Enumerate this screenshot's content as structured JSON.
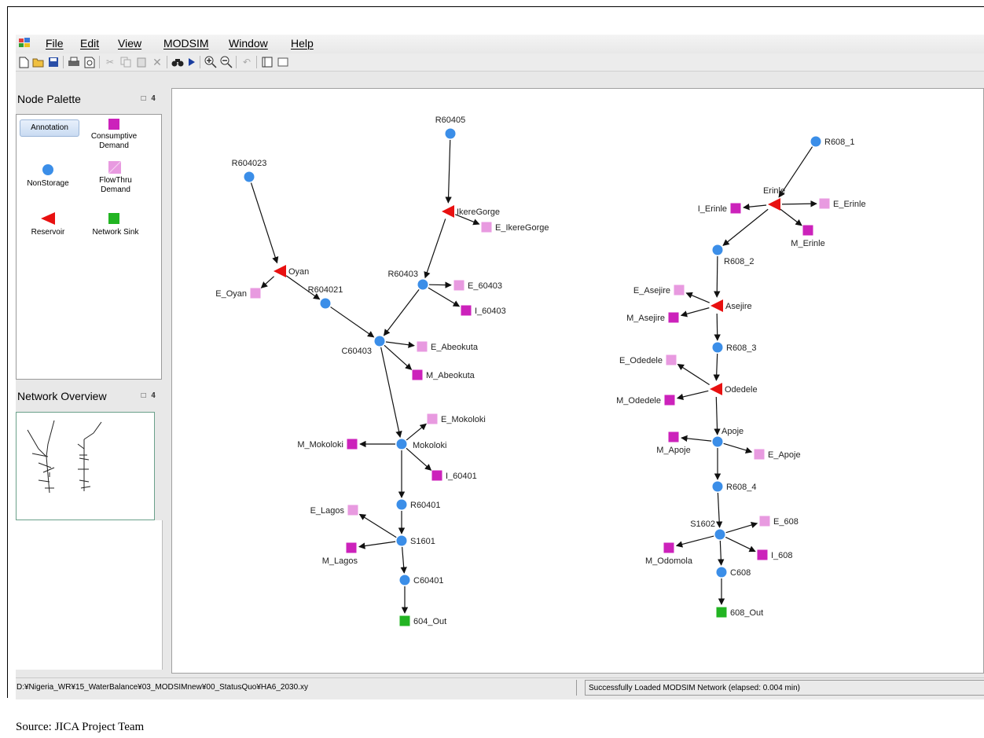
{
  "menu": [
    "File",
    "Edit",
    "View",
    "MODSIM",
    "Window",
    "Help"
  ],
  "panels": {
    "node_palette": "Node Palette",
    "network_overview": "Network Overview",
    "pin": "□ 𝟒"
  },
  "palette": {
    "annotation": "Annotation",
    "consumptive_demand": "Consumptive Demand",
    "nonstorage": "NonStorage",
    "flowthru_demand": "FlowThru Demand",
    "reservoir": "Reservoir",
    "network_sink": "Network Sink"
  },
  "colors": {
    "nonstorage": "#3b8ee8",
    "reservoir": "#e81010",
    "consumptive": "#cc22bb",
    "flowthru": "#e89ae0",
    "sink": "#22b422"
  },
  "network": {
    "nodes": [
      {
        "id": "R604023",
        "type": "nonstorage"
      },
      {
        "id": "Oyan",
        "type": "reservoir"
      },
      {
        "id": "E_Oyan",
        "type": "flowthru"
      },
      {
        "id": "R604021",
        "type": "nonstorage"
      },
      {
        "id": "R60405",
        "type": "nonstorage"
      },
      {
        "id": "IkereGorge",
        "type": "reservoir"
      },
      {
        "id": "E_IkereGorge",
        "type": "flowthru"
      },
      {
        "id": "R60403",
        "type": "nonstorage"
      },
      {
        "id": "E_60403",
        "type": "flowthru"
      },
      {
        "id": "I_60403",
        "type": "consumptive"
      },
      {
        "id": "C60403",
        "type": "nonstorage"
      },
      {
        "id": "E_Abeokuta",
        "type": "flowthru"
      },
      {
        "id": "M_Abeokuta",
        "type": "consumptive"
      },
      {
        "id": "Mokoloki",
        "type": "nonstorage"
      },
      {
        "id": "E_Mokoloki",
        "type": "flowthru"
      },
      {
        "id": "M_Mokoloki",
        "type": "consumptive"
      },
      {
        "id": "I_60401",
        "type": "consumptive"
      },
      {
        "id": "R60401",
        "type": "nonstorage"
      },
      {
        "id": "S1601",
        "type": "nonstorage"
      },
      {
        "id": "E_Lagos",
        "type": "flowthru"
      },
      {
        "id": "M_Lagos",
        "type": "consumptive"
      },
      {
        "id": "C60401",
        "type": "nonstorage"
      },
      {
        "id": "604_Out",
        "type": "sink"
      },
      {
        "id": "R608_1",
        "type": "nonstorage"
      },
      {
        "id": "Erinle",
        "type": "reservoir"
      },
      {
        "id": "I_Erinle",
        "type": "consumptive"
      },
      {
        "id": "E_Erinle",
        "type": "flowthru"
      },
      {
        "id": "M_Erinle",
        "type": "consumptive"
      },
      {
        "id": "R608_2",
        "type": "nonstorage"
      },
      {
        "id": "Asejire",
        "type": "reservoir"
      },
      {
        "id": "E_Asejire",
        "type": "flowthru"
      },
      {
        "id": "M_Asejire",
        "type": "consumptive"
      },
      {
        "id": "R608_3",
        "type": "nonstorage"
      },
      {
        "id": "Odedele",
        "type": "reservoir"
      },
      {
        "id": "E_Odedele",
        "type": "flowthru"
      },
      {
        "id": "M_Odedele",
        "type": "consumptive"
      },
      {
        "id": "Apoje",
        "type": "nonstorage"
      },
      {
        "id": "M_Apoje",
        "type": "consumptive"
      },
      {
        "id": "E_Apoje",
        "type": "flowthru"
      },
      {
        "id": "R608_4",
        "type": "nonstorage"
      },
      {
        "id": "S1602",
        "type": "nonstorage"
      },
      {
        "id": "E_608",
        "type": "flowthru"
      },
      {
        "id": "I_608",
        "type": "consumptive"
      },
      {
        "id": "M_Odomola",
        "type": "consumptive"
      },
      {
        "id": "C608",
        "type": "nonstorage"
      },
      {
        "id": "608_Out",
        "type": "sink"
      }
    ],
    "links": [
      [
        "R604023",
        "Oyan"
      ],
      [
        "Oyan",
        "E_Oyan"
      ],
      [
        "Oyan",
        "R604021"
      ],
      [
        "R604021",
        "C60403"
      ],
      [
        "R60405",
        "IkereGorge"
      ],
      [
        "IkereGorge",
        "E_IkereGorge"
      ],
      [
        "IkereGorge",
        "R60403"
      ],
      [
        "R60403",
        "E_60403"
      ],
      [
        "R60403",
        "I_60403"
      ],
      [
        "R60403",
        "C60403"
      ],
      [
        "C60403",
        "E_Abeokuta"
      ],
      [
        "C60403",
        "M_Abeokuta"
      ],
      [
        "C60403",
        "Mokoloki"
      ],
      [
        "Mokoloki",
        "E_Mokoloki"
      ],
      [
        "Mokoloki",
        "M_Mokoloki"
      ],
      [
        "Mokoloki",
        "I_60401"
      ],
      [
        "Mokoloki",
        "R60401"
      ],
      [
        "R60401",
        "S1601"
      ],
      [
        "S1601",
        "E_Lagos"
      ],
      [
        "S1601",
        "M_Lagos"
      ],
      [
        "S1601",
        "C60401"
      ],
      [
        "C60401",
        "604_Out"
      ],
      [
        "R608_1",
        "Erinle"
      ],
      [
        "Erinle",
        "I_Erinle"
      ],
      [
        "Erinle",
        "E_Erinle"
      ],
      [
        "Erinle",
        "M_Erinle"
      ],
      [
        "Erinle",
        "R608_2"
      ],
      [
        "R608_2",
        "Asejire"
      ],
      [
        "Asejire",
        "E_Asejire"
      ],
      [
        "Asejire",
        "M_Asejire"
      ],
      [
        "Asejire",
        "R608_3"
      ],
      [
        "R608_3",
        "Odedele"
      ],
      [
        "Odedele",
        "E_Odedele"
      ],
      [
        "Odedele",
        "M_Odedele"
      ],
      [
        "Odedele",
        "Apoje"
      ],
      [
        "Apoje",
        "M_Apoje"
      ],
      [
        "Apoje",
        "E_Apoje"
      ],
      [
        "Apoje",
        "R608_4"
      ],
      [
        "R608_4",
        "S1602"
      ],
      [
        "S1602",
        "E_608"
      ],
      [
        "S1602",
        "I_608"
      ],
      [
        "S1602",
        "M_Odomola"
      ],
      [
        "S1602",
        "C608"
      ],
      [
        "C608",
        "608_Out"
      ]
    ]
  },
  "status": {
    "path": "D:¥Nigeria_WR¥15_WaterBalance¥03_MODSIMnew¥00_StatusQuo¥HA6_2030.xy",
    "message": "Successfully Loaded MODSIM Network (elapsed: 0.004 min)"
  },
  "caption": "Source: JICA Project Team"
}
